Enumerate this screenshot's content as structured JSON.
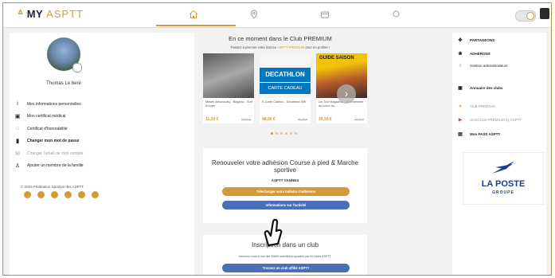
{
  "topbar": {
    "logo_prefix": "MY",
    "logo_main": "ASPTT",
    "nav": [
      {
        "icon": "home-icon"
      },
      {
        "icon": "location-pin-icon"
      },
      {
        "icon": "wallet-icon"
      },
      {
        "icon": "search-icon"
      }
    ]
  },
  "profile": {
    "name": "Thomas Le bere"
  },
  "left_menu": [
    {
      "label": "Mes informations personnelles",
      "icon": "info-icon",
      "glyph": "i"
    },
    {
      "label": "Mon certificat médical",
      "icon": "medical-case-icon",
      "glyph": "▣"
    },
    {
      "label": "Certificat d'honorabilité",
      "icon": "shield-check-icon",
      "glyph": "◌"
    },
    {
      "label": "Changer mon mot de passe",
      "icon": "lock-icon",
      "glyph": "▮"
    },
    {
      "label": "Changer l'email de mon compte",
      "icon": "email-icon",
      "glyph": "✉"
    },
    {
      "label": "Ajouter un membre de la famille",
      "icon": "add-user-icon",
      "glyph": "♙"
    }
  ],
  "copyright": "© 2023 Fédération Sportive des ASPTT",
  "socials": [
    "facebook-icon",
    "instagram-icon",
    "twitter-icon",
    "youtube-icon",
    "linkedin-icon",
    "tiktok-icon"
  ],
  "premium": {
    "title": "En ce moment dans le Club PREMIUM",
    "subtitle_pre": "Passez à premier votre licence",
    "subtitle_link": "ASPTT PREMIUM",
    "subtitle_post": "pour en profiter !",
    "cards": [
      {
        "title": "Musée Aéronautiq... Blagnac - Surf Europe",
        "price": "11,20 €",
        "old_price": "15,00 €"
      },
      {
        "title": "E-Carte Cadeau - Decathlon 50€",
        "price": "48,00 €",
        "old_price": "50,00 €",
        "brand": "DECATHLON",
        "brand_sub": "CARTE CADEAU"
      },
      {
        "title": "Un Tour Magazine... Abonnement au coeur du...",
        "price": "39,20 €",
        "old_price": "49,00 €",
        "banner": "GUIDE SAISON"
      }
    ],
    "dots": 6
  },
  "renewal": {
    "title": "Renouveler votre adhésion Course à pied & Marche sportive",
    "club": "ASPTT VANNES",
    "btn_download": "Télécharger votre bulletin d'adhésion",
    "btn_info": "Informations sur l'activité"
  },
  "signup": {
    "title": "Inscription dans un club",
    "text": "Inscrivez-vous à une des 30600 activités proposées par les clubs ASPTT.",
    "btn": "Trouvez un club affilié ASPTT"
  },
  "right_menu": [
    {
      "label": "PARTAGEONS",
      "icon": "share-icon",
      "glyph": "✤",
      "bold": true
    },
    {
      "label": "ADHÉRONS",
      "icon": "flower-icon",
      "glyph": "❀",
      "bold": true
    },
    {
      "label": "Gestion administrateurs",
      "icon": "admin-users-icon",
      "glyph": "♗"
    },
    {
      "label": "Annuaire des clubs",
      "icon": "directory-icon",
      "glyph": "▣",
      "bold": true
    },
    {
      "label": "Club PREMIUM",
      "icon": "star-icon",
      "glyph": "★",
      "muted": true
    },
    {
      "label": "DIGICLUB PREMIUM by ASPTT",
      "icon": "play-icon",
      "glyph": "▶",
      "muted": true
    },
    {
      "label": "Mon PASS ASPTT",
      "icon": "pass-icon",
      "glyph": "▤",
      "bold": true
    }
  ],
  "ad": {
    "brand": "LA POSTE",
    "sub": "GROUPE"
  },
  "colors": {
    "accent": "#d49a3a",
    "blue": "#4a6fb8",
    "laposte": "#1d3d8f"
  }
}
